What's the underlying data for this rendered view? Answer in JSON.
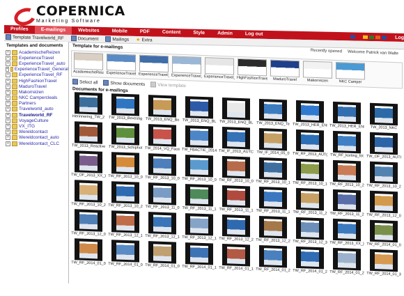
{
  "app": {
    "name": "COPERNICA",
    "subtitle": "Marketing Software"
  },
  "nav": {
    "items": [
      "Profiles",
      "E-mailings",
      "Websites",
      "Mobile",
      "PDF",
      "Content",
      "Style",
      "Admin",
      "Log out"
    ],
    "active": "E-mailings",
    "logout_right": "Log",
    "flag_colors": [
      "#1f4fa8",
      "#c1121c",
      "#f0c020",
      "#2a7a2a",
      "#e06020",
      "#1f4fa8"
    ]
  },
  "toolbar": {
    "template": "Template Travelworld_RF",
    "document": "Document",
    "mailings": "Mailings",
    "extra": "Extra"
  },
  "sidebar": {
    "title": "Templates and documents",
    "items": [
      {
        "label": "AcademischeReizen",
        "bold": false
      },
      {
        "label": "ExperienceTravel",
        "bold": false
      },
      {
        "label": "ExperienceTravel_auto",
        "bold": false
      },
      {
        "label": "ExperienceTravel_General",
        "bold": false
      },
      {
        "label": "ExperienceTravel_RF",
        "bold": false
      },
      {
        "label": "HighFashionTravel",
        "bold": false
      },
      {
        "label": "MaduroTravel",
        "bold": false
      },
      {
        "label": "Makorreizen",
        "bold": false
      },
      {
        "label": "NKC Campercleals",
        "bold": false
      },
      {
        "label": "Partners",
        "bold": false
      },
      {
        "label": "Travelworld_auto",
        "bold": false
      },
      {
        "label": "Travelworld_RF",
        "bold": true
      },
      {
        "label": "VoyageCulture",
        "bold": false
      },
      {
        "label": "VX_ITG",
        "bold": false
      },
      {
        "label": "Wereldcontact",
        "bold": false
      },
      {
        "label": "Wereldcontact_auto",
        "bold": false
      },
      {
        "label": "Wereldcontact_CLC",
        "bold": false
      }
    ]
  },
  "main": {
    "recently_opened": "Recently opened",
    "welcome": "Welcome Patrick van Walte",
    "templates_label": "Template for e-mailings",
    "templates": [
      {
        "caption": "AcademischeReizen",
        "color": "#d9cfc2"
      },
      {
        "caption": "ExperienceTravel",
        "color": "#5b8bc4"
      },
      {
        "caption": "ExperienceTravel_",
        "color": "#3f6ea8"
      },
      {
        "caption": "ExperienceTravel_",
        "color": "#9ab7d6"
      },
      {
        "caption": "ExperienceTravel_",
        "color": "#e6e6e6"
      },
      {
        "caption": "HighFashionTravel",
        "color": "#2b2b2b"
      },
      {
        "caption": "MaduroTravel",
        "color": "#1f3f8a"
      },
      {
        "caption": "Makorreizen",
        "color": "#f2f2f2"
      },
      {
        "caption": "NKC Camper",
        "color": "#4a9ad4"
      }
    ],
    "select_all": "Select all",
    "show_documents": "Show documents",
    "view_template": "View template",
    "documents_label": "Documents for e-mailings",
    "documents": [
      {
        "caption": "Herinnering_TW_2",
        "color": "#3c6e9c"
      },
      {
        "caption": "TW_2013_Bevestig",
        "color": "#2f76c2"
      },
      {
        "caption": "TW_2013_ENQ_Bo",
        "color": "#c79a56"
      },
      {
        "caption": "TW_2013_ENQ_BL",
        "color": "#2d5aa8"
      },
      {
        "caption": "TW_2013_ENQ_BL",
        "color": "#e9e9e9"
      },
      {
        "caption": "TW_2013_ENQ_Te",
        "color": "#3d7bbf"
      },
      {
        "caption": "TW_2013_HER_ENI",
        "color": "#2f7ad0"
      },
      {
        "caption": "TW_2013_HER_ENI",
        "color": "#336fb0"
      },
      {
        "caption": "TW_2013_NKC",
        "color": "#2b6aa6"
      },
      {
        "caption": "TW_2013_Reactive",
        "color": "#a05a3a"
      },
      {
        "caption": "TW_2013_Schiphol",
        "color": "#5d8f3c"
      },
      {
        "caption": "TW_2014_VQ_Face",
        "color": "#c9534a"
      },
      {
        "caption": "TW_FBACTIE_2014",
        "color": "#4d86c6"
      },
      {
        "caption": "TW_IF_2013_AUTC",
        "color": "#3472b8"
      },
      {
        "caption": "TW_IF_2014_05_0",
        "color": "#c6a166"
      },
      {
        "caption": "TW_RF_2013_AUT(",
        "color": "#2d6fb6"
      },
      {
        "caption": "TW_RF_korting_fot",
        "color": "#3f80c4"
      },
      {
        "caption": "TW_OF_2013_AUTI",
        "color": "#2c64a8"
      },
      {
        "caption": "TW_OF_2013_XX_)",
        "color": "#7a5d8c"
      },
      {
        "caption": "TW_RF_2013_10_0",
        "color": "#d68b3a"
      },
      {
        "caption": "TW_RF_2013_10_0",
        "color": "#4c7fbc"
      },
      {
        "caption": "TW_RF_2013_10_0",
        "color": "#5a9acf"
      },
      {
        "caption": "TW_RF_2013_10_0",
        "color": "#b86b4a"
      },
      {
        "caption": "TW_RF_2013_10_1",
        "color": "#3e6f9e"
      },
      {
        "caption": "TW_RF_2013_10_1",
        "color": "#8c9c4a"
      },
      {
        "caption": "TW_RF_2013_10_2",
        "color": "#c97c55"
      },
      {
        "caption": "TW_RF_2013_10_2",
        "color": "#5282b0"
      },
      {
        "caption": "TW_RF_2013_10_2",
        "color": "#d8b078"
      },
      {
        "caption": "TW_RF_2013_10_2",
        "color": "#2f6bb0"
      },
      {
        "caption": "TW_RF_2013_11_0",
        "color": "#7a9cc4"
      },
      {
        "caption": "TW_RF_2013_11_1",
        "color": "#4f8a5a"
      },
      {
        "caption": "TW_RF_2013_11_1",
        "color": "#b04a3f"
      },
      {
        "caption": "TW_RF_2013_11_1",
        "color": "#3b78c0"
      },
      {
        "caption": "TW_RF_2013_11_2",
        "color": "#c8a064"
      },
      {
        "caption": "TW_RF_2013_11_2",
        "color": "#5a6fa8"
      },
      {
        "caption": "TW_RF_2013_12_0",
        "color": "#d29a4c"
      },
      {
        "caption": "TW_RF_2013_12_0",
        "color": "#4f7fb6"
      },
      {
        "caption": "TW_RF_2013_12_1",
        "color": "#c06d4a"
      },
      {
        "caption": "TW_RF_2013_12_1",
        "color": "#3a74b8"
      },
      {
        "caption": "TW_RF_2013_12_1",
        "color": "#86a4c8"
      },
      {
        "caption": "TW_RF_2013_12_2",
        "color": "#2f6ab0"
      },
      {
        "caption": "TW_RF_2013_12_2",
        "color": "#a5784a"
      },
      {
        "caption": "TW_RF_2013_12_3",
        "color": "#6b8fb8"
      },
      {
        "caption": "TW_RF_2013_XX_)",
        "color": "#3c7ac0"
      },
      {
        "caption": "TW_RF_2014_01_0",
        "color": "#7a8f4a"
      },
      {
        "caption": "TW_RF_2014_01_0",
        "color": "#cf8a4a"
      },
      {
        "caption": "TW_RF_2014_01_0",
        "color": "#5b8bc4"
      },
      {
        "caption": "TW_RF_2014_01_0",
        "color": "#c0a070"
      },
      {
        "caption": "TW_RF_2014_01_1",
        "color": "#3d73b4"
      },
      {
        "caption": "TW_RF_2014_01_1",
        "color": "#b35a44"
      },
      {
        "caption": "TW_RF_2014_01_2",
        "color": "#4a80be"
      },
      {
        "caption": "TW_RF_2014_01_2",
        "color": "#2f6cb3"
      },
      {
        "caption": "TW_RF_2014_01_2",
        "color": "#9cb2cc"
      },
      {
        "caption": "TW_RF_2014_01_3",
        "color": "#d69a52"
      }
    ]
  }
}
